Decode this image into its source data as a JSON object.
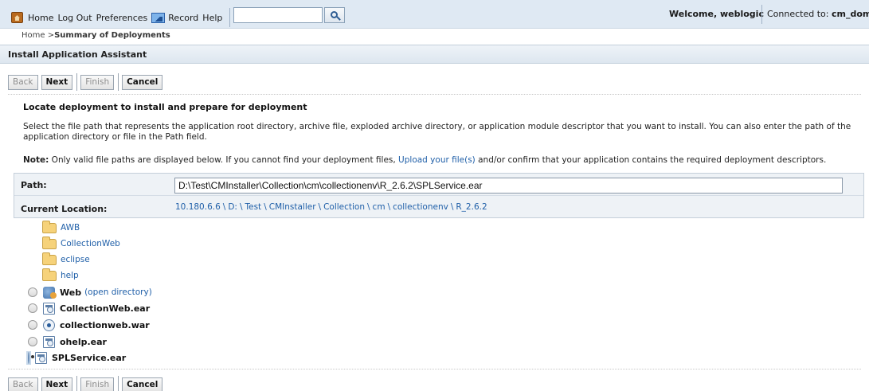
{
  "topbar": {
    "links": [
      "Home",
      "Log Out",
      "Preferences",
      "Record",
      "Help"
    ],
    "search_value": "",
    "welcome": "Welcome, weblogic",
    "connected_prefix": "Connected to: ",
    "connected_domain": "cm_domai"
  },
  "breadcrumb": {
    "home": "Home >",
    "current": "Summary of Deployments"
  },
  "section_title": "Install Application Assistant",
  "buttons": {
    "back": "Back",
    "next": "Next",
    "finish": "Finish",
    "cancel": "Cancel"
  },
  "content": {
    "heading": "Locate deployment to install and prepare for deployment",
    "description": "Select the file path that represents the application root directory, archive file, exploded archive directory, or application module descriptor that you want to install. You can also enter the path of the application directory or file in the Path field.",
    "note_label": "Note:",
    "note_before": " Only valid file paths are displayed below. If you cannot find your deployment files, ",
    "note_link": "Upload your file(s)",
    "note_after": " and/or confirm that your application contains the required deployment descriptors."
  },
  "path_table": {
    "path_label": "Path:",
    "path_value": "D:\\Test\\CMInstaller\\Collection\\cm\\collectionenv\\R_2.6.2\\SPLService.ear",
    "location_label": "Current Location:",
    "location_crumbs": [
      "10.180.6.6",
      "D:",
      "Test",
      "CMInstaller",
      "Collection",
      "cm",
      "collectionenv",
      "R_2.6.2"
    ]
  },
  "folders": [
    "AWB",
    "CollectionWeb",
    "eclipse",
    "help"
  ],
  "deployables": [
    {
      "name": "Web",
      "extra": "(open directory)",
      "icon": "web-folder-icon",
      "selected": false
    },
    {
      "name": "CollectionWeb.ear",
      "extra": "",
      "icon": "ear-file-icon",
      "selected": false
    },
    {
      "name": "collectionweb.war",
      "extra": "",
      "icon": "war-file-icon",
      "selected": false
    },
    {
      "name": "ohelp.ear",
      "extra": "",
      "icon": "ear-file-icon",
      "selected": false
    },
    {
      "name": "SPLService.ear",
      "extra": "",
      "icon": "ear-file-icon",
      "selected": true
    }
  ]
}
